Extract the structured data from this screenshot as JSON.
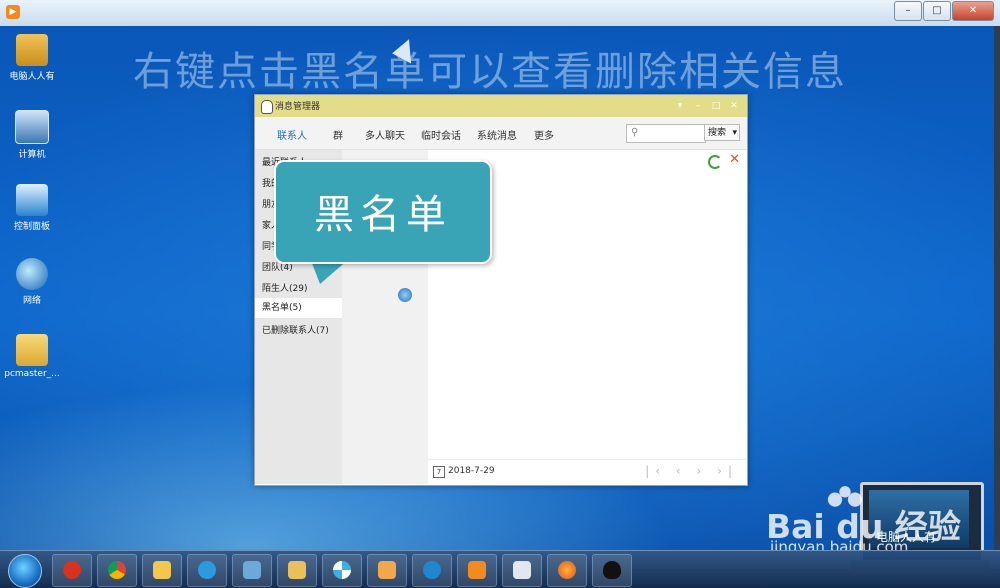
{
  "banner": "右键点击黑名单可以查看删除相关信息",
  "desktop_icons": [
    {
      "label": "电脑人人有",
      "icon": "user-folder-icon"
    },
    {
      "label": "计算机",
      "icon": "computer-icon"
    },
    {
      "label": "控制面板",
      "icon": "control-panel-icon"
    },
    {
      "label": "网络",
      "icon": "network-icon"
    },
    {
      "label": "pcmaster_...",
      "icon": "folder-icon"
    }
  ],
  "window": {
    "title": "消息管理器",
    "tabs": [
      "联系人",
      "群",
      "多人聊天",
      "临时会话",
      "系统消息",
      "更多"
    ],
    "active_tab": "联系人",
    "search_button": "搜索",
    "sidebar": [
      {
        "label": "最近联系人"
      },
      {
        "label": "我的好友"
      },
      {
        "label": "朋友"
      },
      {
        "label": "家人"
      },
      {
        "label": "同学"
      },
      {
        "label": "团队(4)"
      },
      {
        "label": "陌生人(29)"
      },
      {
        "label": "黑名单(5)"
      },
      {
        "label": "已删除联系人(7)"
      }
    ],
    "footer_date": "2018-7-29",
    "calendar_glyph": "7"
  },
  "callout": "黑名单",
  "watermark": {
    "brand": "Bai du 经验",
    "url": "jingyan.baidu.com",
    "laptop_text": "电脑人人有"
  },
  "player": {
    "close": "✕",
    "min": "–",
    "max": "□"
  },
  "taskbar_apps": [
    "start",
    "jiang",
    "chrome",
    "folder",
    "qq-browser",
    "monitor",
    "explorer",
    "pinwheel",
    "paint",
    "ie",
    "media",
    "box",
    "firefox",
    "qq"
  ],
  "colors": {
    "callout": "#3aa4b7",
    "title_bar": "#e3dc88",
    "active_tab": "#1f6fbf"
  }
}
